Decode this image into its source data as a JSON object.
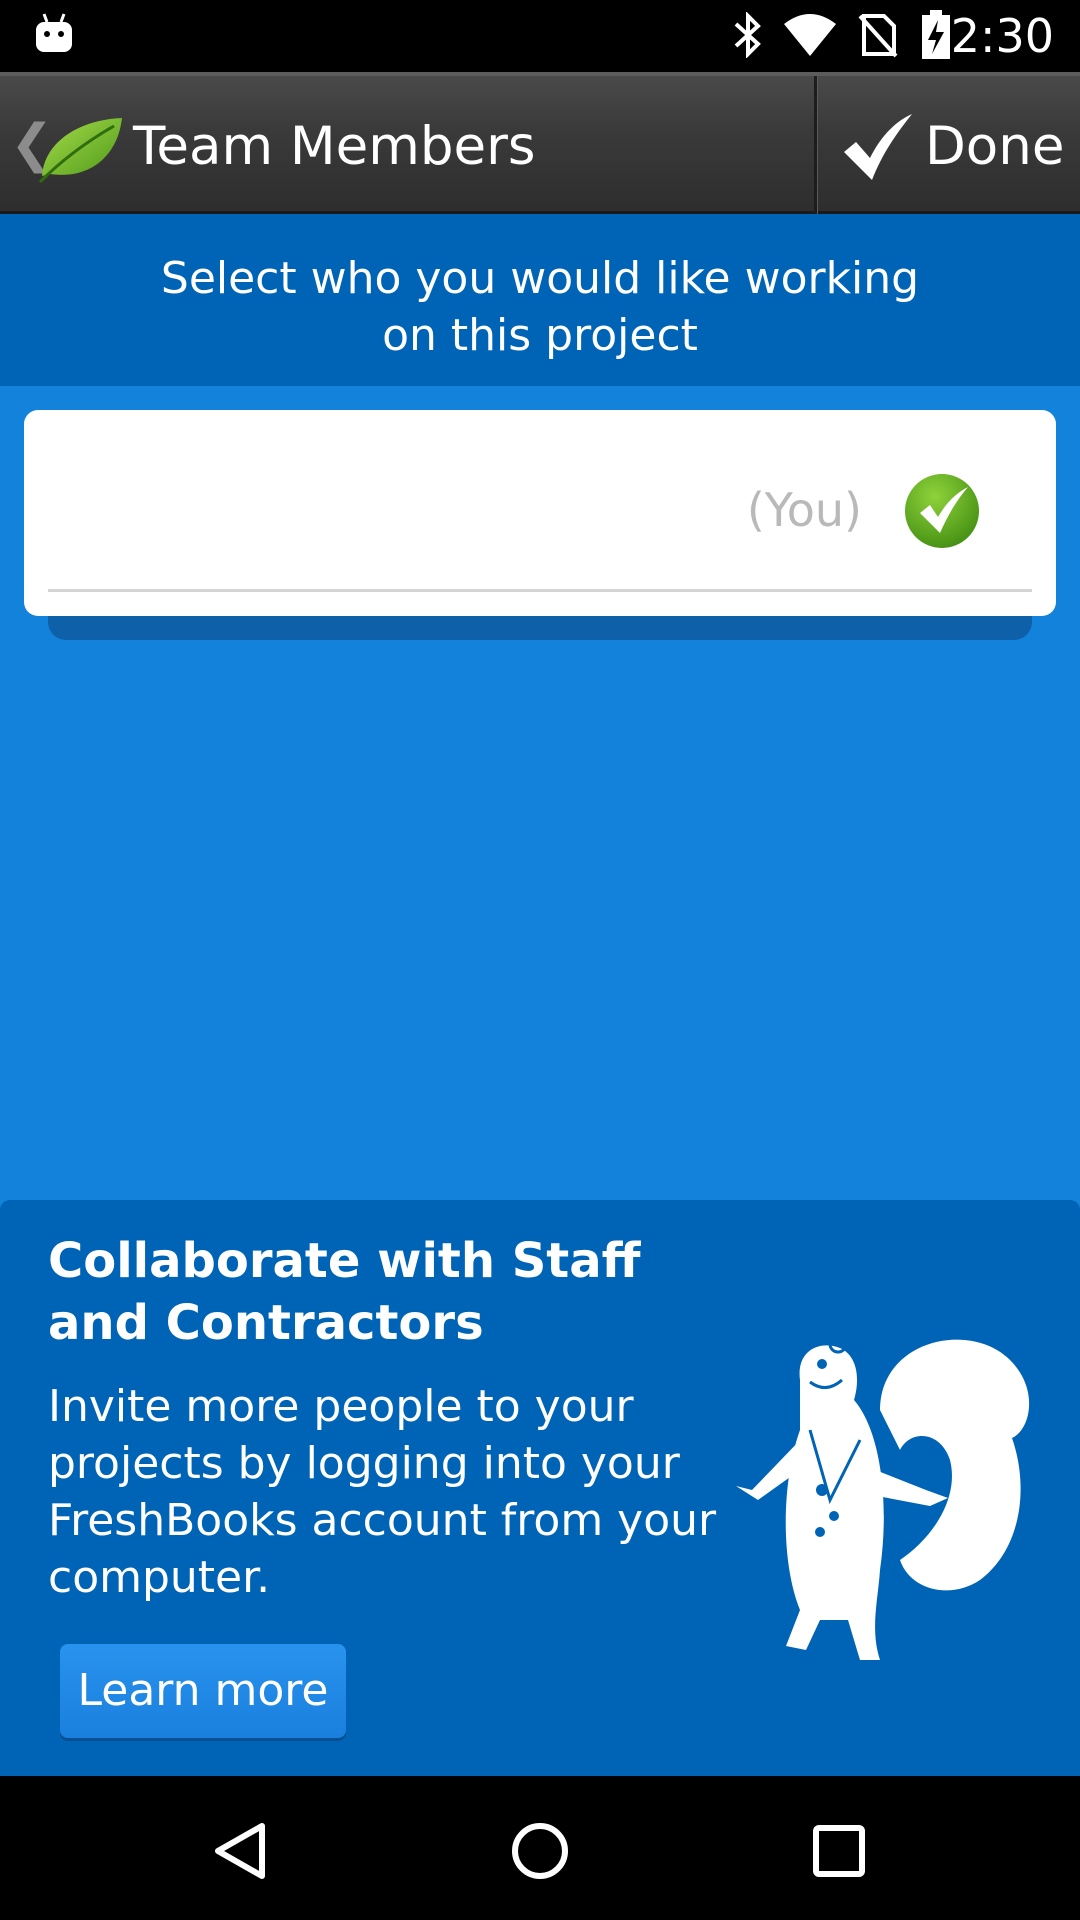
{
  "status_bar": {
    "time": "2:30",
    "icons": [
      "android-debug-icon",
      "bluetooth-icon",
      "wifi-icon",
      "no-sim-icon",
      "battery-charging-icon"
    ]
  },
  "action_bar": {
    "title": "Team Members",
    "back_icon": "chevron-left-icon",
    "logo_icon": "leaf-logo-icon",
    "done_label": "Done",
    "done_icon": "checkmark-icon"
  },
  "instruction": {
    "text": "Select who you would like working\non this project"
  },
  "members": [
    {
      "name": "",
      "tag": "(You)",
      "selected": true
    }
  ],
  "promo": {
    "title": "Collaborate with Staff and Contractors",
    "body": "Invite more people to your projects by logging into your FreshBooks account from your computer.",
    "button_label": "Learn more",
    "image": "squirrel-mascot-icon"
  },
  "nav_bar": {
    "buttons": [
      "back-nav-icon",
      "home-nav-icon",
      "recents-nav-icon"
    ]
  },
  "colors": {
    "background": "#1282db",
    "header_blue": "#0064b6",
    "check_green": "#5fa820",
    "action_bar": "#3a3a3a"
  }
}
